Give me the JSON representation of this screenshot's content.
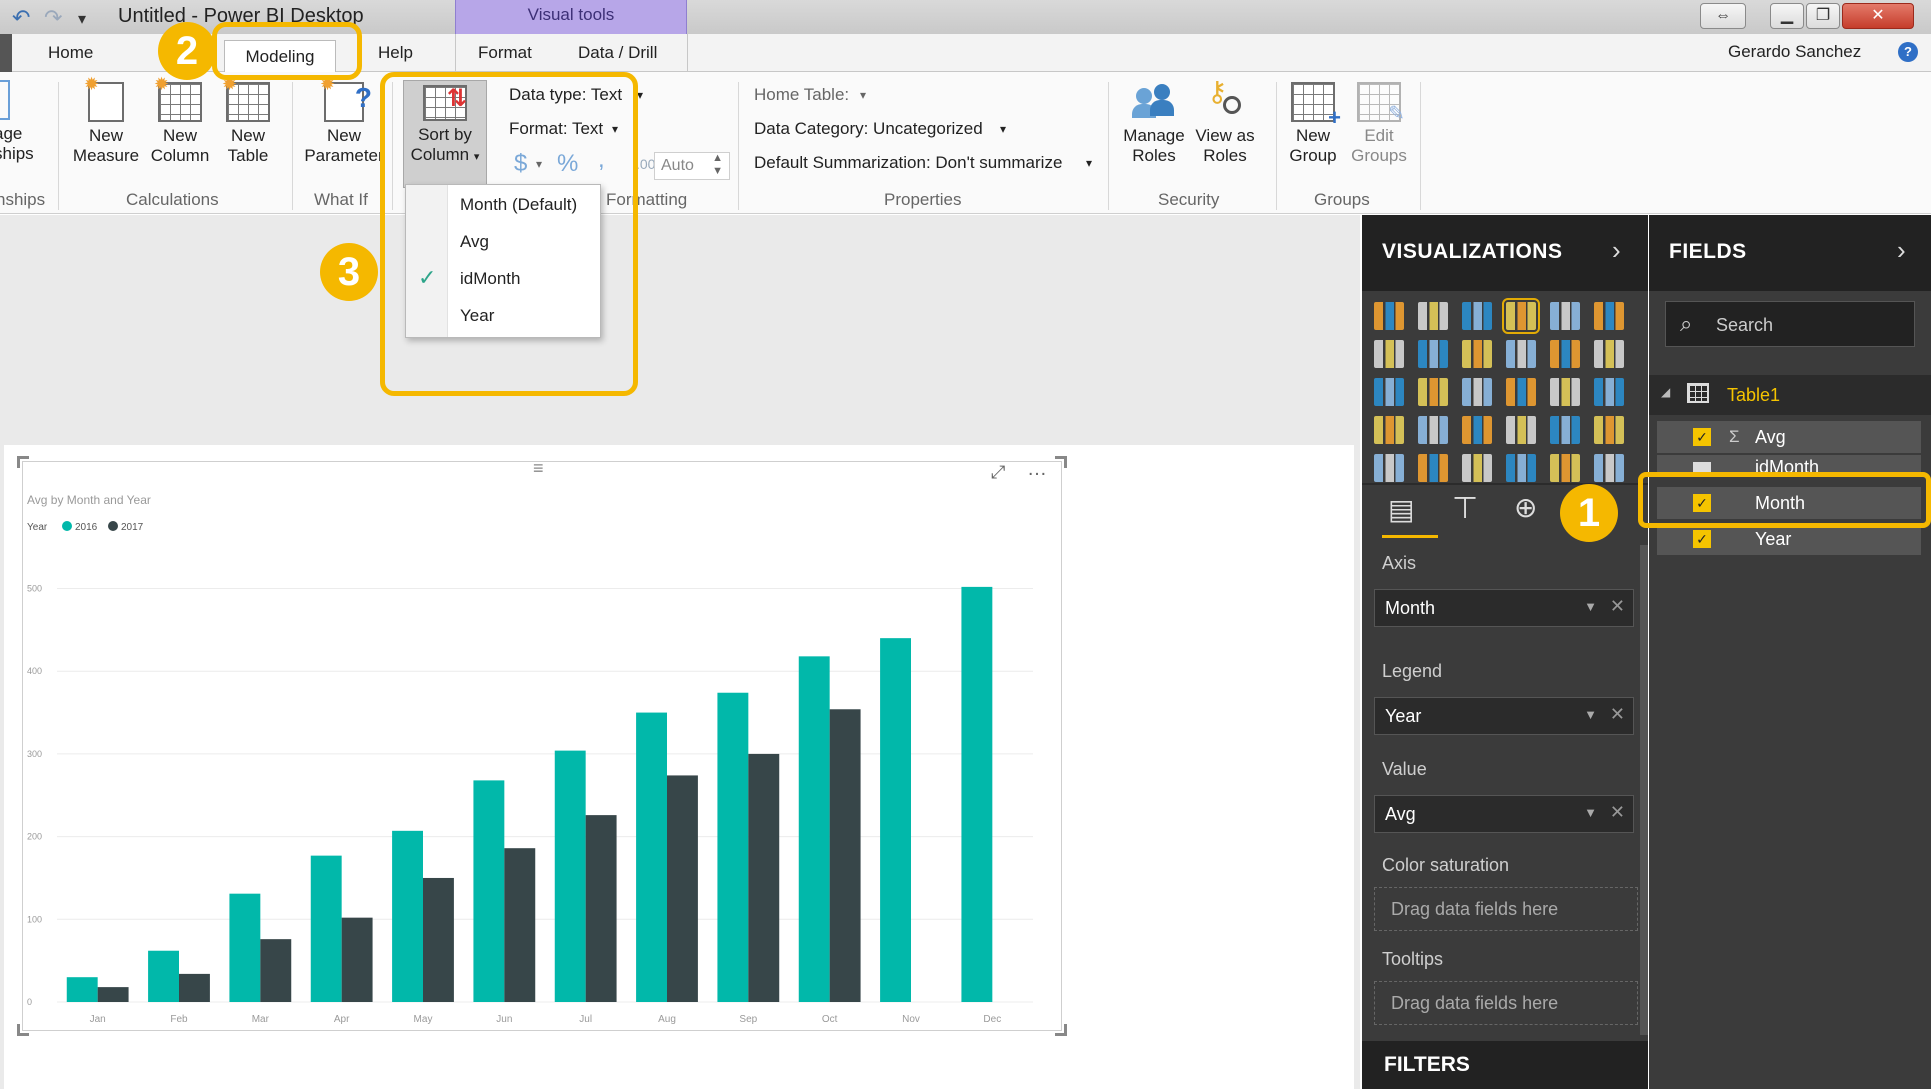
{
  "window": {
    "title": "Untitled - Power BI Desktop",
    "context_tab": "Visual tools",
    "user": "Gerardo Sanchez"
  },
  "tabs": [
    "Home",
    "Modeling",
    "Help",
    "Format",
    "Data / Drill"
  ],
  "ribbon": {
    "relationships": {
      "button": "age\nships",
      "group": "nships"
    },
    "calculations": {
      "new_measure": "New\nMeasure",
      "new_column": "New\nColumn",
      "new_table": "New\nTable",
      "group": "Calculations"
    },
    "whatif": {
      "new_parameter": "New\nParameter",
      "group": "What If"
    },
    "sort": {
      "sort_by_column": "Sort by\nColumn"
    },
    "formatting": {
      "data_type": "Data type: Text",
      "format": "Format: Text",
      "currency": "$",
      "percent": "%",
      "comma": ",",
      "decimal": ".00",
      "auto": "Auto",
      "group": "Formatting"
    },
    "properties": {
      "home_table": "Home Table:",
      "data_category": "Data Category: Uncategorized",
      "default_summarization": "Default Summarization: Don't summarize",
      "group": "Properties"
    },
    "security": {
      "manage_roles": "Manage\nRoles",
      "view_as_roles": "View as\nRoles",
      "group": "Security"
    },
    "groups": {
      "new_group": "New\nGroup",
      "edit_groups": "Edit\nGroups",
      "group": "Groups"
    }
  },
  "sort_menu": {
    "items": [
      "Month (Default)",
      "Avg",
      "idMonth",
      "Year"
    ],
    "checked": "idMonth"
  },
  "badges": [
    "1",
    "2",
    "3"
  ],
  "visualizations": {
    "title": "VISUALIZATIONS",
    "wells": {
      "axis_label": "Axis",
      "axis_field": "Month",
      "legend_label": "Legend",
      "legend_field": "Year",
      "value_label": "Value",
      "value_field": "Avg",
      "color_label": "Color saturation",
      "color_placeholder": "Drag data fields here",
      "tooltips_label": "Tooltips",
      "tooltips_placeholder": "Drag data fields here"
    },
    "filters_title": "FILTERS"
  },
  "fields": {
    "title": "FIELDS",
    "search_placeholder": "Search",
    "table": "Table1",
    "items": [
      "Avg",
      "idMonth",
      "Month",
      "Year"
    ]
  },
  "chart_data": {
    "type": "bar",
    "title": "Avg by Month and Year",
    "legend_title": "Year",
    "categories": [
      "Jan",
      "Feb",
      "Mar",
      "Apr",
      "May",
      "Jun",
      "Jul",
      "Aug",
      "Sep",
      "Oct",
      "Nov",
      "Dec"
    ],
    "series": [
      {
        "name": "2016",
        "color": "#01b8aa",
        "values": [
          30,
          62,
          131,
          177,
          207,
          268,
          304,
          350,
          374,
          418,
          440,
          502
        ]
      },
      {
        "name": "2017",
        "color": "#374649",
        "values": [
          18,
          34,
          76,
          102,
          150,
          186,
          226,
          274,
          300,
          354,
          null,
          null
        ]
      }
    ],
    "y_ticks": [
      0,
      100,
      200,
      300,
      400,
      500
    ],
    "ylim": [
      0,
      520
    ],
    "grid": true,
    "legend_position": "top-left"
  },
  "colors": {
    "accent": "#f5b800",
    "series_2016": "#01b8aa",
    "series_2017": "#374649",
    "pane_bg": "#3b3b3b"
  }
}
